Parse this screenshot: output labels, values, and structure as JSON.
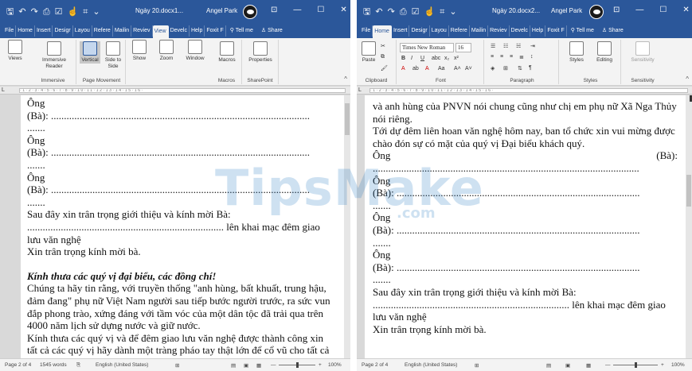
{
  "left": {
    "title": "Ngày 20.docx1...",
    "user": "Angel Park",
    "tabs": [
      "File",
      "Home",
      "Insert",
      "Design",
      "Layout",
      "References",
      "Mailings",
      "Review",
      "View",
      "Developer",
      "Help",
      "Foxit F"
    ],
    "tabs_short": [
      "File",
      "Home",
      "Insert",
      "Desigr",
      "Layou",
      "Refere",
      "Mailin",
      "Reviev",
      "View",
      "Develc",
      "Help",
      "Foxit F"
    ],
    "tellme": "Tell me",
    "share": "Share",
    "active_tab": "View",
    "ribbon": {
      "views": "Views",
      "immersive_reader": "Immersive Reader",
      "vertical": "Vertical",
      "side_to_side": "Side to Side",
      "show": "Show",
      "zoom": "Zoom",
      "window": "Window",
      "macros": "Macros",
      "properties": "Properties",
      "group_immersive": "Immersive",
      "group_page_movement": "Page Movement",
      "group_macros": "Macros",
      "group_sharepoint": "SharePoint"
    },
    "lines": [
      "Ông",
      "(Bà): ....................................................................................................",
      ".......",
      "Ông",
      "(Bà): ....................................................................................................",
      ".......",
      "Ông",
      "(Bà): ....................................................................................................",
      ".......",
      "Sau đây xin trân trọng giới thiệu và kính mời Bà:",
      "............................................................................ lên khai mạc đêm giao",
      "lưu văn nghệ",
      "Xin trân trọng kính mời bà.",
      "",
      "Kính thưa các quý vị đại biểu, các đồng chí!",
      "Chúng ta hãy tin rằng, với truyền thống \"anh hùng, bất khuất, trung hậu,",
      "đảm đang\" phụ nữ Việt Nam người sau tiếp bước người trước, ra sức vun",
      "đắp phong trào, xứng đáng với tầm vóc của một dân tộc đã trải qua trên",
      "4000 năm lịch sử dựng nước và giữ nước.",
      "Kính thưa các quý vị và để đêm giao lưu văn nghệ được thành công xin",
      "tất cả các quý vị hãy dành một tràng pháo tay thật lớn để cổ vũ cho tất cả"
    ],
    "status": {
      "page": "Page 2 of 4",
      "words": "1545 words",
      "language": "English (United States)",
      "zoom": "100%",
      "zoom_level": 0.5
    }
  },
  "right": {
    "title": "Ngày 20.docx2...",
    "user": "Angel Park",
    "tabs_short": [
      "File",
      "Home",
      "Insert",
      "Desigr",
      "Layou",
      "Refere",
      "Mailin",
      "Reviev",
      "Develc",
      "Help",
      "Foxit F"
    ],
    "tellme": "Tell me",
    "share": "Share",
    "active_tab": "Home",
    "ribbon": {
      "paste": "Paste",
      "font_name": "Times New Roman",
      "font_size": "16",
      "bold": "B",
      "italic": "I",
      "underline": "U",
      "styles": "Styles",
      "editing": "Editing",
      "sensitivity": "Sensitivity",
      "group_clipboard": "Clipboard",
      "group_font": "Font",
      "group_paragraph": "Paragraph",
      "group_styles": "Styles",
      "group_sensitivity": "Sensitivity"
    },
    "lines": [
      "và anh hùng của PNVN nói chung cũng như chị em phụ nữ Xã Nga Thủy",
      "nói riêng.",
      "Tới dự đêm liên hoan văn nghệ hôm nay, ban tổ chức xin vui mừng được",
      "chào đón sự có mặt của quý vị Đại biểu khách quý.",
      "Ông",
      ".......................................................................................................",
      "Ông",
      "(Bà): ..............................................................................................",
      ".......",
      "Ông",
      "(Bà): ..............................................................................................",
      ".......",
      "Ông",
      "(Bà): ..............................................................................................",
      ".......",
      "Sau đây xin trân trọng giới thiệu và kính mời Bà:",
      "............................................................................ lên khai mạc đêm giao",
      "lưu văn nghệ",
      "Xin trân trọng kính mời bà."
    ],
    "ong_ba_right": "(Bà):",
    "status": {
      "page": "Page 2 of 4",
      "language": "English (United States)",
      "zoom": "100%",
      "zoom_level": 0.5
    }
  },
  "watermark": {
    "text": "TipsMake",
    "suffix": ".com"
  },
  "colors": {
    "word_blue": "#2b579a",
    "ribbon_bg": "#f3f3f3",
    "doc_bg": "#d9d9d9"
  }
}
